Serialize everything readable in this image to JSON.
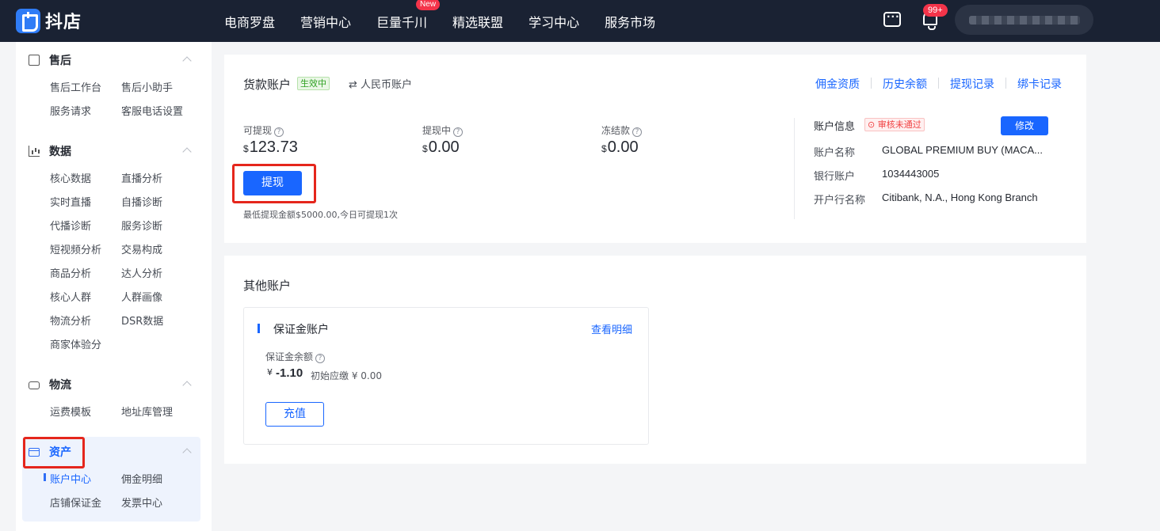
{
  "topbar": {
    "logo_text": "抖店",
    "nav": [
      "电商罗盘",
      "营销中心",
      "巨量千川",
      "精选联盟",
      "学习中心",
      "服务市场"
    ],
    "new_badge": "New",
    "notif_count": "99+"
  },
  "sidebar": {
    "sections": [
      {
        "title": "售后",
        "icon": "box-icon",
        "items": [
          "售后工作台",
          "售后小助手",
          "服务请求",
          "客服电话设置"
        ]
      },
      {
        "title": "数据",
        "icon": "chart-icon",
        "items": [
          "核心数据",
          "直播分析",
          "实时直播",
          "自播诊断",
          "代播诊断",
          "服务诊断",
          "短视频分析",
          "交易构成",
          "商品分析",
          "达人分析",
          "核心人群",
          "人群画像",
          "物流分析",
          "DSR数据",
          "商家体验分"
        ]
      },
      {
        "title": "物流",
        "icon": "truck-icon",
        "items": [
          "运费模板",
          "地址库管理"
        ]
      },
      {
        "title": "资产",
        "icon": "card-icon",
        "items": [
          "账户中心",
          "佣金明细",
          "店铺保证金",
          "发票中心"
        ]
      }
    ]
  },
  "account": {
    "title": "货款账户",
    "status": "生效中",
    "switch_label": "⇄ 人民币账户",
    "links": [
      "佣金资质",
      "历史余额",
      "提现记录",
      "绑卡记录"
    ],
    "balances": [
      {
        "label": "可提现",
        "currency": "$",
        "amount": "123.73"
      },
      {
        "label": "提现中",
        "currency": "$",
        "amount": "0.00"
      },
      {
        "label": "冻结款",
        "currency": "$",
        "amount": "0.00"
      }
    ],
    "withdraw_button": "提现",
    "withdraw_note": "最低提现金额$5000.00,今日可提现1次",
    "info": {
      "title": "账户信息",
      "review_status": "审核未通过",
      "edit_button": "修改",
      "rows": [
        {
          "label": "账户名称",
          "value": "GLOBAL PREMIUM BUY (MACA..."
        },
        {
          "label": "银行账户",
          "value": "1034443005"
        },
        {
          "label": "开户行名称",
          "value": "Citibank, N.A., Hong Kong Branch"
        }
      ]
    }
  },
  "other": {
    "title": "其他账户",
    "deposit": {
      "title": "保证金账户",
      "detail_link": "查看明细",
      "balance_label": "保证金余额",
      "currency": "¥",
      "amount": "-1.10",
      "initial": "初始应缴 ¥ 0.00",
      "recharge_button": "充值"
    }
  }
}
